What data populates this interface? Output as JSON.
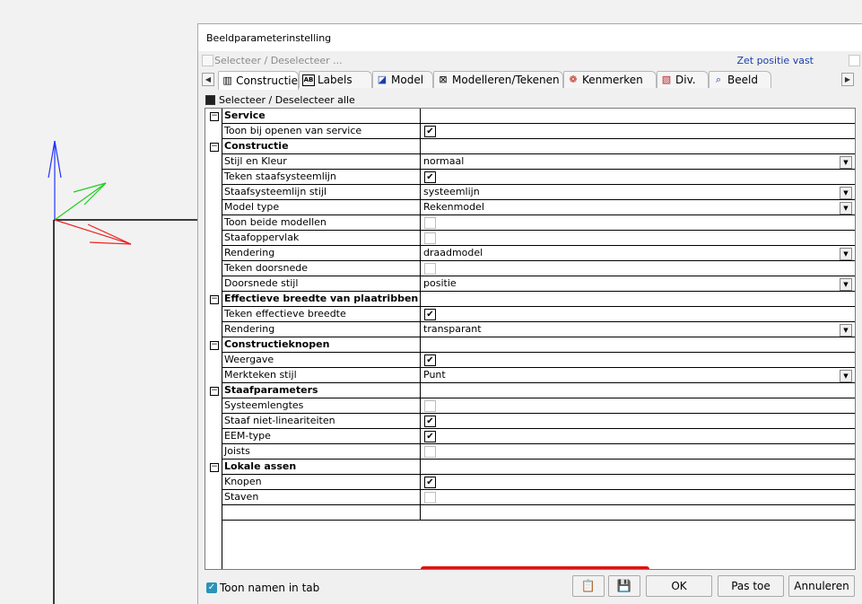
{
  "dialog": {
    "title": "Beeldparameterinstelling",
    "header_select_label": "Selecteer / Deselecteer ...",
    "pin_label": "Zet positie vast",
    "select_all_label": "Selecteer / Deselecteer alle",
    "show_names_label": "Toon namen in tab",
    "show_names_checked": true
  },
  "tabs": [
    {
      "label": "Constructie",
      "icon": "building-icon",
      "active": true
    },
    {
      "label": "Labels",
      "icon": "labels-icon",
      "active": false
    },
    {
      "label": "Model",
      "icon": "model-icon",
      "active": false
    },
    {
      "label": "Modelleren/Tekenen",
      "icon": "drawing-icon",
      "active": false
    },
    {
      "label": "Kenmerken",
      "icon": "palette-icon",
      "active": false
    },
    {
      "label": "Div.",
      "icon": "misc-icon",
      "active": false
    },
    {
      "label": "Beeld",
      "icon": "view-icon",
      "active": false
    }
  ],
  "grid": [
    {
      "type": "category",
      "label": "Service"
    },
    {
      "type": "check",
      "label": "Toon bij openen van service",
      "checked": true
    },
    {
      "type": "category",
      "label": "Constructie"
    },
    {
      "type": "select",
      "label": "Stijl en Kleur",
      "value": "normaal"
    },
    {
      "type": "check",
      "label": "Teken staafsysteemlijn",
      "checked": true
    },
    {
      "type": "select",
      "label": "Staafsysteemlijn stijl",
      "value": "systeemlijn"
    },
    {
      "type": "select",
      "label": "Model type",
      "value": "Rekenmodel"
    },
    {
      "type": "check",
      "label": "Toon beide modellen",
      "checked": false
    },
    {
      "type": "check",
      "label": "Staafoppervlak",
      "checked": false
    },
    {
      "type": "select",
      "label": "Rendering",
      "value": "draadmodel"
    },
    {
      "type": "check",
      "label": "Teken doorsnede",
      "checked": false
    },
    {
      "type": "select",
      "label": "Doorsnede stijl",
      "value": "positie"
    },
    {
      "type": "category",
      "label": "Effectieve breedte van plaatribben"
    },
    {
      "type": "check",
      "label": "Teken effectieve breedte",
      "checked": true
    },
    {
      "type": "select",
      "label": "Rendering",
      "value": "transparant"
    },
    {
      "type": "category",
      "label": "Constructieknopen"
    },
    {
      "type": "check",
      "label": "Weergave",
      "checked": true
    },
    {
      "type": "select",
      "label": "Merkteken stijl",
      "value": "Punt"
    },
    {
      "type": "category",
      "label": "Staafparameters"
    },
    {
      "type": "check",
      "label": "Systeemlengtes",
      "checked": false
    },
    {
      "type": "check",
      "label": "Staaf niet-lineariteiten",
      "checked": true
    },
    {
      "type": "check",
      "label": "EEM-type",
      "checked": true
    },
    {
      "type": "check",
      "label": "Joists",
      "checked": false
    },
    {
      "type": "category",
      "label": "Lokale assen"
    },
    {
      "type": "check",
      "label": "Knopen",
      "checked": true
    },
    {
      "type": "check",
      "label": "Staven",
      "checked": false
    },
    {
      "type": "empty",
      "label": ""
    }
  ],
  "buttons": {
    "ok": "OK",
    "apply": "Pas toe",
    "cancel": "Annuleren"
  },
  "colors": {
    "axis_z": "#2233ff",
    "axis_y": "#22cc22",
    "axis_x": "#ee2222",
    "highlight": "#e01010"
  }
}
